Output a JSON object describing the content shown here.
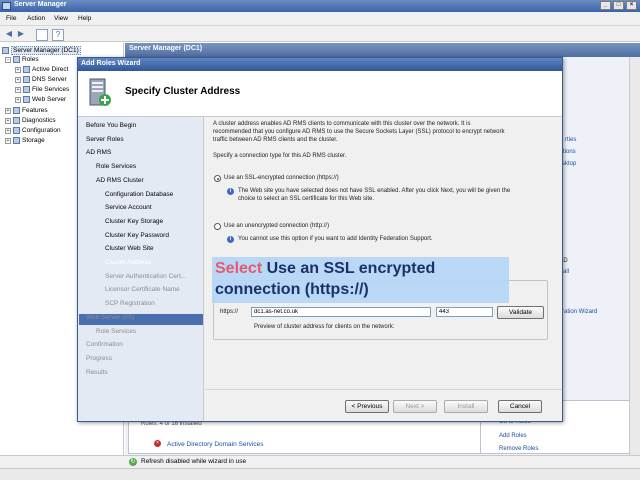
{
  "window": {
    "title": "Server Manager"
  },
  "menu": [
    "File",
    "Action",
    "View",
    "Help"
  ],
  "tree": {
    "root": "Server Manager (DC1)",
    "roles": "Roles",
    "role_items": [
      "Active Direct",
      "DNS Server",
      "File Services",
      "Web Server"
    ],
    "others": [
      "Features",
      "Diagnostics",
      "Configuration",
      "Storage"
    ]
  },
  "right_pane": {
    "header": "Server Manager (DC1)",
    "side_links": [
      "rties",
      "tions",
      "sktop",
      "er after AD",
      "all",
      "ration Wizard"
    ],
    "roles_line": "Roles: 4 of 16 installed",
    "ad_ds_link": "Active Directory Domain Services",
    "actions": [
      "Go to Roles",
      "Add Roles",
      "Remove Roles"
    ]
  },
  "wizard": {
    "title": "Add Roles Wizard",
    "heading": "Specify Cluster Address",
    "nav": [
      {
        "label": "Before You Begin",
        "state": "normal",
        "indent": 0
      },
      {
        "label": "Server Roles",
        "state": "normal",
        "indent": 0
      },
      {
        "label": "AD RMS",
        "state": "normal",
        "indent": 0
      },
      {
        "label": "Role Services",
        "state": "normal",
        "indent": 1
      },
      {
        "label": "AD RMS Cluster",
        "state": "normal",
        "indent": 1
      },
      {
        "label": "Configuration Database",
        "state": "normal",
        "indent": 2
      },
      {
        "label": "Service Account",
        "state": "normal",
        "indent": 2
      },
      {
        "label": "Cluster Key Storage",
        "state": "normal",
        "indent": 2
      },
      {
        "label": "Cluster Key Password",
        "state": "normal",
        "indent": 2
      },
      {
        "label": "Cluster Web Site",
        "state": "normal",
        "indent": 2
      },
      {
        "label": "Cluster Address",
        "state": "current",
        "indent": 2
      },
      {
        "label": "Server Authentication Cert...",
        "state": "disabled",
        "indent": 2
      },
      {
        "label": "Licensor Certificate Name",
        "state": "disabled",
        "indent": 2
      },
      {
        "label": "SCP Registration",
        "state": "disabled",
        "indent": 2
      },
      {
        "label": "Web Server (IIS)",
        "state": "disabled",
        "indent": 0
      },
      {
        "label": "Role Services",
        "state": "disabled",
        "indent": 1
      },
      {
        "label": "Confirmation",
        "state": "disabled",
        "indent": 0
      },
      {
        "label": "Progress",
        "state": "disabled",
        "indent": 0
      },
      {
        "label": "Results",
        "state": "disabled",
        "indent": 0
      }
    ],
    "intro_lines": [
      "A cluster address enables AD RMS clients to communicate with this cluster over the network. It is",
      "recommended that you configure AD RMS to use the Secure Sockets Layer (SSL) protocol to encrypt network",
      "traffic between AD RMS clients and the cluster."
    ],
    "connection_prompt": "Specify a connection type for this AD RMS cluster.",
    "option_ssl": "Use an SSL-encrypted connection (https://)",
    "option_ssl_selected": true,
    "ssl_note_lines": [
      "The Web site you have selected does not have SSL enabled. After you click Next, you will be given the",
      "choice to select an SSL certificate for this Web site."
    ],
    "option_unencrypted": "Use an unencrypted connection (http://)",
    "unencrypted_note": "You cannot use this option if you want to add Identity Federation Support.",
    "protocol_label": "https://",
    "fqdn_value": "dc1.as-net.co.uk",
    "port_value": "443",
    "validate_label": "Validate",
    "preview_label": "Preview of cluster address for clients on the network:",
    "buttons": {
      "previous": "< Previous",
      "next": "Next >",
      "install": "Install",
      "cancel": "Cancel"
    }
  },
  "callout": {
    "highlight": "Select",
    "line1_rest": "Use an SSL encrypted",
    "line2": "connection (https://)"
  },
  "status": {
    "text": "Refresh disabled while wizard in use"
  },
  "colors": {
    "titlebar": "#3b63a8",
    "nav_selected": "#4a6fb0",
    "callout_bg": "#b4d6f6",
    "callout_highlight": "#e8596f"
  }
}
